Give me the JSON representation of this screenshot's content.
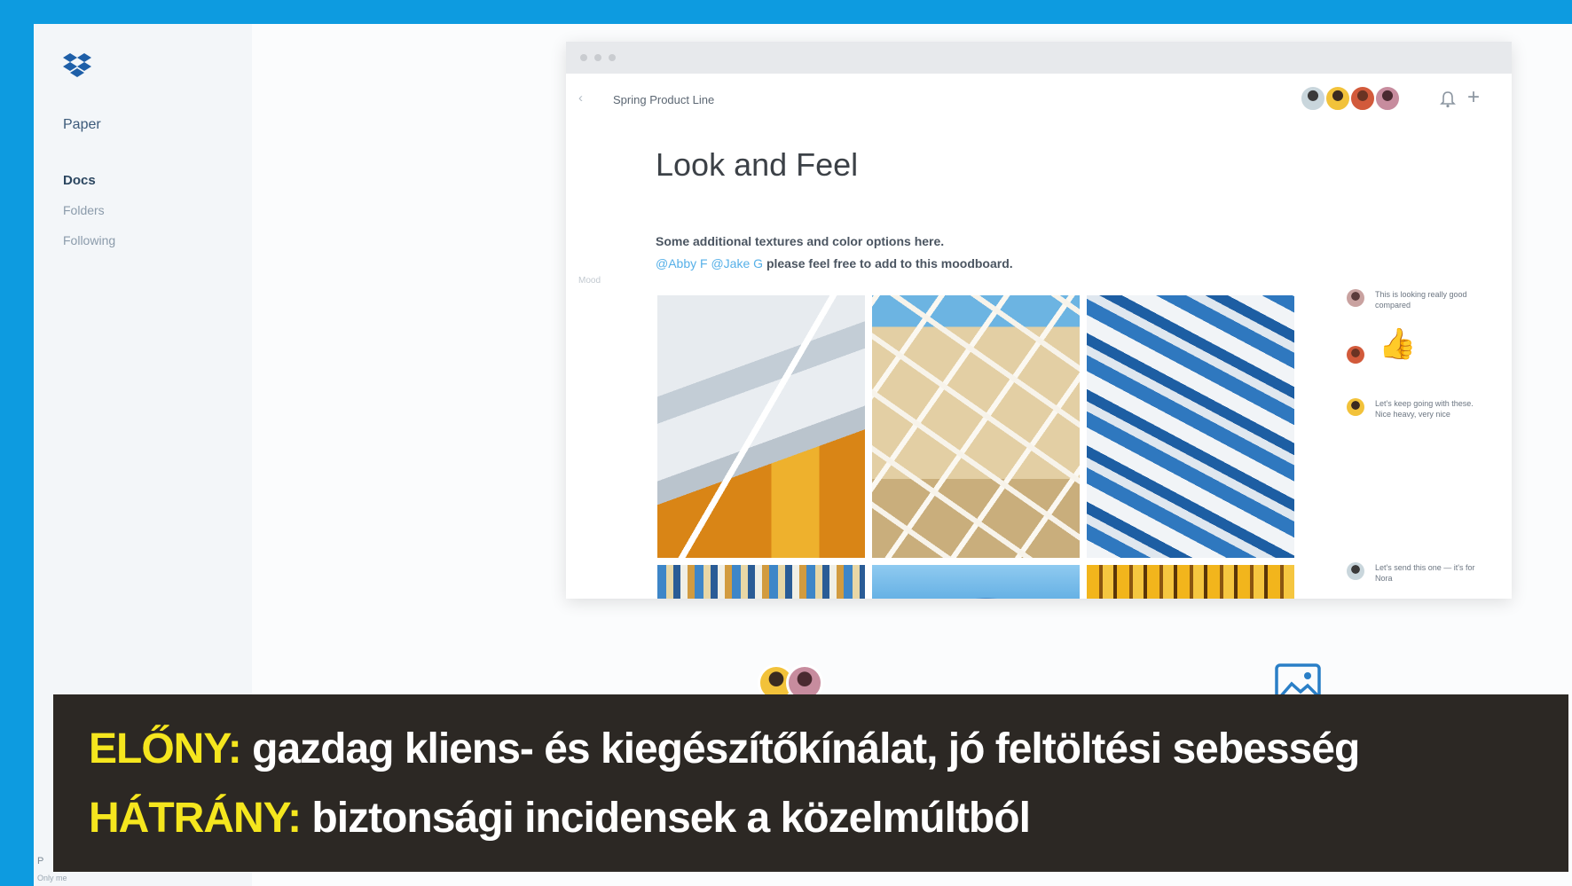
{
  "sidebar": {
    "app_name": "Paper",
    "nav": [
      "Docs",
      "Folders",
      "Following"
    ],
    "footer_label": "P",
    "footer_sub": "Only me"
  },
  "document": {
    "breadcrumb": "Spring Product Line",
    "title": "Look and Feel",
    "line1": "Some additional textures and color options here.",
    "mention1": "@Abby F",
    "mention2": "@Jake G",
    "line2_rest": "please feel free to add to this moodboard.",
    "side_label": "Mood"
  },
  "comments": [
    {
      "text": "This is looking really good compared"
    },
    {
      "text": "Let's keep going with these. Nice heavy, very nice"
    },
    {
      "text": "Let's send this one — it's for Nora"
    }
  ],
  "banner": {
    "pro_label": "ELŐNY:",
    "pro_text": "gazdag kliens- és kiegészítőkínálat, jó feltöltési sebesség",
    "con_label": "HÁTRÁNY:",
    "con_text": "biztonsági incidensek a közelmúltból"
  },
  "colors": {
    "frame_blue": "#0d9be0",
    "banner_bg": "#2c2824",
    "label_yellow": "#f5e61e",
    "mention_blue": "#56b0e8"
  },
  "icons": [
    "dropbox-logo-icon",
    "back-arrow-icon",
    "bell-icon",
    "plus-icon",
    "thumbs-up-icon",
    "image-icon"
  ]
}
